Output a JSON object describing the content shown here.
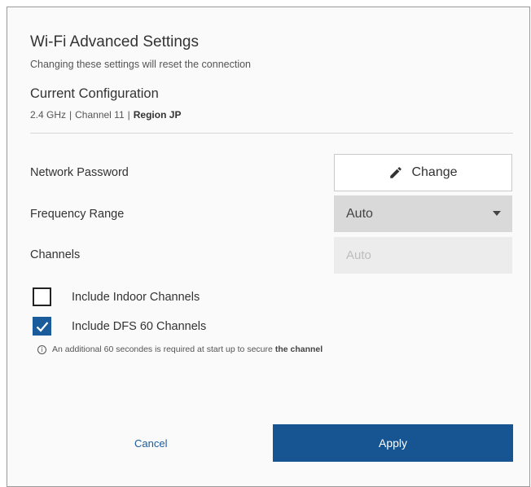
{
  "dialog": {
    "title": "Wi-Fi Advanced Settings",
    "subtitle": "Changing these settings will reset the connection"
  },
  "current_config": {
    "heading": "Current Configuration",
    "frequency": "2.4 GHz",
    "separator": "|",
    "channel": "Channel 11",
    "region": "Region JP"
  },
  "fields": {
    "network_password": {
      "label": "Network Password",
      "button_label": "Change",
      "icon": "pencil-icon"
    },
    "frequency_range": {
      "label": "Frequency Range",
      "selected": "Auto",
      "icon": "caret-down-icon"
    },
    "channels": {
      "label": "Channels",
      "value": "Auto"
    }
  },
  "options": {
    "indoor": {
      "label": "Include Indoor Channels",
      "checked": false
    },
    "dfs": {
      "label": "Include DFS 60 Channels",
      "checked": true
    }
  },
  "info": {
    "icon": "info-icon",
    "text": "An additional 60 secondes is required at start up to secure",
    "emphasis": "the channel"
  },
  "actions": {
    "cancel_label": "Cancel",
    "apply_label": "Apply"
  },
  "colors": {
    "accent": "#175592",
    "select_bg": "#d9d9d9"
  }
}
